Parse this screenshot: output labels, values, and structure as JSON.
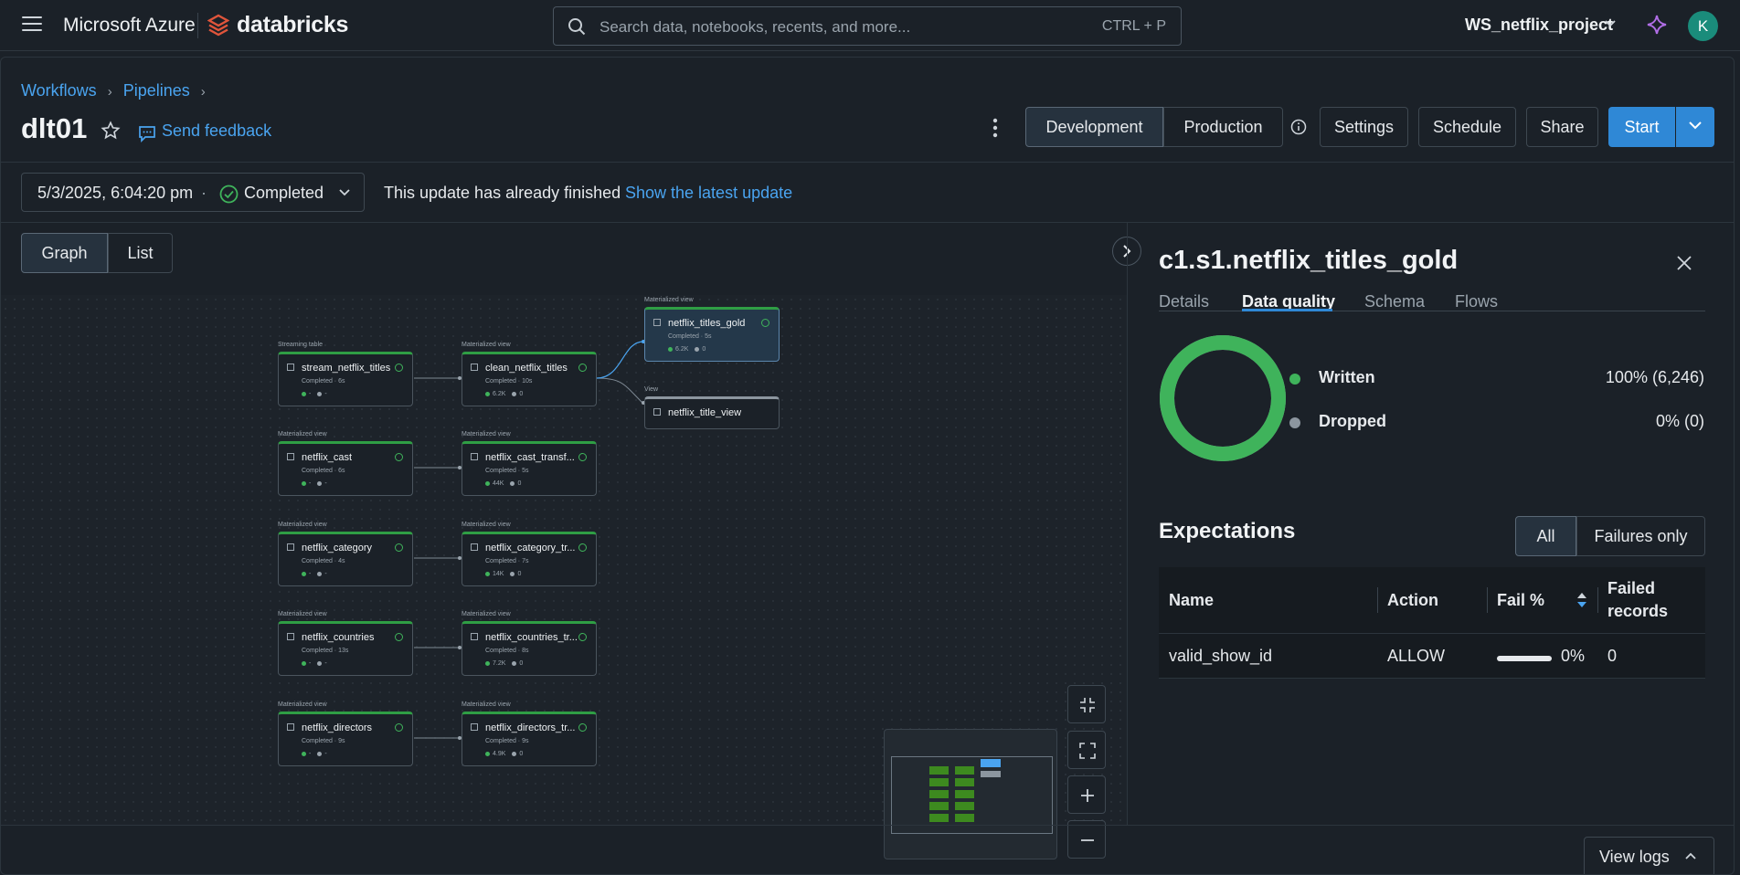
{
  "topbar": {
    "brand_ms": "Microsoft Azure",
    "brand_db": "databricks",
    "search_placeholder": "Search data, notebooks, recents, and more...",
    "search_shortcut": "CTRL + P",
    "workspace": "WS_netflix_project",
    "avatar_letter": "K"
  },
  "breadcrumb": {
    "workflows": "Workflows",
    "pipelines": "Pipelines"
  },
  "pipeline": {
    "title": "dlt01",
    "feedback": "Send feedback",
    "mode_development": "Development",
    "mode_production": "Production",
    "settings": "Settings",
    "schedule": "Schedule",
    "share": "Share",
    "start": "Start"
  },
  "update": {
    "date": "5/3/2025, 6:04:20 pm",
    "separator": "·",
    "status": "Completed",
    "finished_msg": "This update has already finished",
    "latest_link": "Show the latest update"
  },
  "view_tabs": {
    "graph": "Graph",
    "list": "List"
  },
  "graph": {
    "nodes": [
      {
        "type": "Streaming table",
        "name": "stream_netflix_titles",
        "sub": "Completed · 6s",
        "meta1": "-",
        "meta2": "-"
      },
      {
        "type": "Materialized view",
        "name": "clean_netflix_titles",
        "sub": "Completed · 10s",
        "meta1": "6.2K",
        "meta2": "0"
      },
      {
        "type": "Materialized view",
        "name": "netflix_titles_gold",
        "sub": "Completed · 5s",
        "meta1": "6.2K",
        "meta2": "0"
      },
      {
        "type": "View",
        "name": "netflix_title_view",
        "sub": "",
        "meta1": "",
        "meta2": ""
      },
      {
        "type": "Materialized view",
        "name": "netflix_cast",
        "sub": "Completed · 6s",
        "meta1": "-",
        "meta2": "-"
      },
      {
        "type": "Materialized view",
        "name": "netflix_cast_transf...",
        "sub": "Completed · 5s",
        "meta1": "44K",
        "meta2": "0"
      },
      {
        "type": "Materialized view",
        "name": "netflix_category",
        "sub": "Completed · 4s",
        "meta1": "-",
        "meta2": "-"
      },
      {
        "type": "Materialized view",
        "name": "netflix_category_tr...",
        "sub": "Completed · 7s",
        "meta1": "14K",
        "meta2": "0"
      },
      {
        "type": "Materialized view",
        "name": "netflix_countries",
        "sub": "Completed · 13s",
        "meta1": "-",
        "meta2": "-"
      },
      {
        "type": "Materialized view",
        "name": "netflix_countries_tr...",
        "sub": "Completed · 8s",
        "meta1": "7.2K",
        "meta2": "0"
      },
      {
        "type": "Materialized view",
        "name": "netflix_directors",
        "sub": "Completed · 9s",
        "meta1": "-",
        "meta2": "-"
      },
      {
        "type": "Materialized view",
        "name": "netflix_directors_tr...",
        "sub": "Completed · 9s",
        "meta1": "4.9K",
        "meta2": "0"
      }
    ]
  },
  "detail": {
    "title": "c1.s1.netflix_titles_gold",
    "tabs": [
      "Details",
      "Data quality",
      "Schema",
      "Flows"
    ],
    "active_tab": "Data quality",
    "written_label": "Written",
    "written_value": "100% (6,246)",
    "dropped_label": "Dropped",
    "dropped_value": "0% (0)",
    "written_fraction": 1.0,
    "colors": {
      "written": "#3fb35b",
      "dropped": "#8c969f",
      "accent": "#2f88d6"
    },
    "expectations_title": "Expectations",
    "filter_all": "All",
    "filter_failures": "Failures only",
    "columns": {
      "name": "Name",
      "action": "Action",
      "fail": "Fail %",
      "failed_records": "Failed records"
    },
    "rows": [
      {
        "name": "valid_show_id",
        "action": "ALLOW",
        "fail_pct": "0%",
        "failed": "0"
      }
    ]
  },
  "footer": {
    "view_logs": "View logs"
  }
}
